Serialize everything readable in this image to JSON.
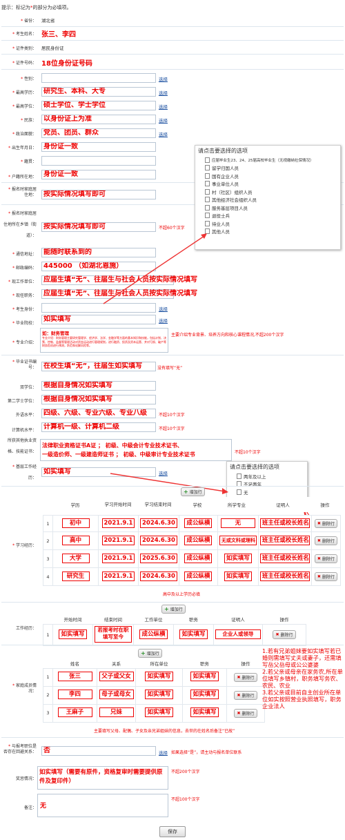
{
  "tip": {
    "prefix": "提示：标记为",
    "star": "*",
    "suffix": "的部分为必填项。"
  },
  "fields": {
    "province": {
      "label": "省份：",
      "value": "湖北省"
    },
    "name": {
      "label": "考生姓名：",
      "value": "张三、李四"
    },
    "id_type": {
      "label": "证件类别：",
      "value": "居民身份证"
    },
    "id_no": {
      "label": "证件号码：",
      "value": "18位身份证号码"
    },
    "gender": {
      "label": "性别："
    },
    "edu": {
      "label": "最高学历：",
      "value": "研究生、本科、大专"
    },
    "degree": {
      "label": "最高学位：",
      "value": "硕士学位、学士学位"
    },
    "nation": {
      "label": "民族：",
      "value": "以身份证上为准"
    },
    "politics": {
      "label": "政治面貌：",
      "value": "党员、团员、群众"
    },
    "birth": {
      "label": "出生年月日：",
      "value": "身份证一致"
    },
    "origin": {
      "label": "籍贯："
    },
    "hukou": {
      "label": "户籍所在地：",
      "value": "身份证一致"
    },
    "apply_addr": {
      "label1": "报名时家庭居",
      "label2": "住地：",
      "value": "按实际情况填写即可"
    },
    "apply_addr2": {
      "label1": "报名时家庭居",
      "label2": "住地所在乡镇（街",
      "label3": "道）：",
      "value": "按实际情况填写即可",
      "note": "不超60个汉字"
    },
    "addr": {
      "label": "通信地址：",
      "value": "能随时联系到的"
    },
    "zip": {
      "label": "邮政编码：",
      "value": "445000 （如湖北恩施）"
    },
    "work": {
      "label": "现工作单位：",
      "value": "应届生填“无”、往届生与社会人员按实际情况填写"
    },
    "post": {
      "label": "现任职务：",
      "value": "应届生填“无”、往届生与社会人员按实际情况填写"
    },
    "identity": {
      "label": "考生身份："
    },
    "school": {
      "label": "毕业院校：",
      "value": "如实填写"
    },
    "major": {
      "label": "专业介绍：",
      "line1": "如：财务管理",
      "line2": "专业介绍：财务管理主要研究管理学、经济学、法学、金融学等方面的基本知识和技能，包括计划、决策、控制、监督等管理活动对资金运动进行管理规划，进行融资、投资及资本运营、并对亏损、破产等财务危机进行预测，防范和化解风险等。",
      "note": "主要介绍专业背景、培养方向和核心课程情况,不超200个汉字"
    },
    "cert_no": {
      "label1": "毕业证书编",
      "label2": "号：",
      "value": "在校生填“无”，往届生如实填写",
      "note": "没有填写“无”"
    },
    "double": {
      "label": "双学位：",
      "value": "根据自身情况如实填写"
    },
    "second": {
      "label": "第二学士学位：",
      "value": "根据自身情况如实填写"
    },
    "foreign": {
      "label": "外语水平：",
      "value": "四级、六级、专业六级、专业八级",
      "note": "不超10个汉字"
    },
    "computer": {
      "label": "计算机水平：",
      "value": "计算机一级、计算机二级",
      "note": "不超10个汉字"
    },
    "skills": {
      "label1": "所获其他执业资",
      "label2": "格、技能证书：",
      "line1": "法律职业资格证书A证 ； 初级、中级会计专业技术证书、",
      "line2": "一级造价师、一级建造师证书 ； 初级、中级审计专业技术证书",
      "note": "不超10个汉字"
    },
    "years": {
      "label1": "基层工作经",
      "label2": "历：",
      "value": "如实填写"
    }
  },
  "choose_label": "选择",
  "popup1": {
    "title": "请点击要选择的选项",
    "options": [
      "应届毕业生23、24、25届高校毕业生（无视缴纳社保情况）",
      "留学归国人员",
      "国有企业人员",
      "事业单位人员",
      "村（社区）组织人员",
      "其他经济社会组织人员",
      "服务基层项目人员",
      "退役士兵",
      "待业人员",
      "其他人员"
    ]
  },
  "popup2": {
    "title": "请点击要选择的选项",
    "options": [
      "两年及以上",
      "不足两年",
      "无"
    ]
  },
  "study": {
    "label": "学习经历：",
    "add": "增加行",
    "headers": [
      "",
      "学历",
      "学习开始时间",
      "学习结束时间",
      "学校",
      "所学专业",
      "证明人",
      "操作"
    ],
    "rows": [
      [
        "1",
        "初中",
        "2021.9.1",
        "2024.6.30",
        "成公纵横",
        "无",
        "班主任或校长姓名"
      ],
      [
        "2",
        "高中",
        "2021.9.1",
        "2024.6.30",
        "成公纵横",
        "无或文科或理科",
        "班主任或校长姓名"
      ],
      [
        "3",
        "大学",
        "2021.9.1",
        "2025.6.30",
        "成公纵横",
        "如实填写",
        "班主任或校长姓名"
      ],
      [
        "4",
        "研究生",
        "2021.9.1",
        "2024.6.30",
        "成公纵横",
        "如实填写",
        "班主任或校长姓名"
      ]
    ],
    "del": "删除行",
    "note": "高中及以上学历必填"
  },
  "work_exp": {
    "label": "工作经历：",
    "add": "增加行",
    "headers": [
      "",
      "开始时间",
      "结束时间",
      "工作单位",
      "职务",
      "证明人",
      "操作"
    ],
    "rows": [
      [
        "1",
        "如实填写",
        "若报考时在职填写至今",
        "成公纵横",
        "如实填写",
        "企业人或领导",
        "删除行"
      ]
    ]
  },
  "family": {
    "label1": "家庭成员情",
    "label2": "况：",
    "add": "增加行",
    "headers": [
      "",
      "姓名",
      "关系",
      "所在单位",
      "职务",
      "操作"
    ],
    "rows": [
      [
        "1",
        "张三",
        "父子或父女",
        "如实填写",
        "如实填写"
      ],
      [
        "2",
        "李四",
        "母子或母女",
        "如实填写",
        "如实填写"
      ],
      [
        "3",
        "王麻子",
        "兄妹",
        "如实填写",
        "如实填写"
      ]
    ],
    "del": "删除行",
    "note": "主要填写父母、配偶、子女及亲兄弟姐妹的信息，去世的在姓名后备注“已故”",
    "ann": "1.若有兄弟姐妹要如实填写若已婚则需填写丈夫或妻子，还需填写岳父岳母或公公婆婆\n2.若父亲或母亲在家务农,所在单位填写乡镇村，职务填写务农、农民、农业\n3.若父亲或目前自主创业所在单位如实按照营业执照填写，职务企业法人"
  },
  "relative": {
    "label1": "与报考职位是",
    "label2": "否存在回避关系：",
    "value": "否",
    "note": "如果选择“是”，请主动与报名单位联系"
  },
  "award": {
    "label": "奖惩情况：",
    "value": "如实填写（需要有原件，资格复审时需要提供原件及复印件）",
    "note": "不超200个汉字"
  },
  "remark": {
    "label": "备注：",
    "value": "无",
    "note": "不超100个汉字"
  },
  "save": "保存"
}
